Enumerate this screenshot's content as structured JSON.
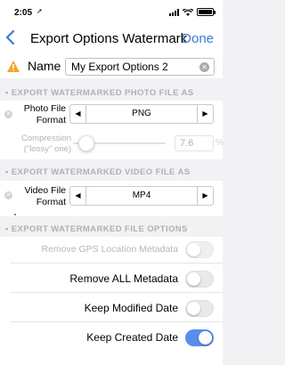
{
  "status_bar": {
    "time": "2:05",
    "location_arrow": "➚"
  },
  "nav": {
    "title": "Export Options Watermark",
    "done_label": "Done"
  },
  "name_row": {
    "label": "Name",
    "value": "My Export Options 2"
  },
  "photo_section": {
    "header": "EXPORT WATERMARKED PHOTO FILE AS",
    "format_label": "Photo File Format",
    "format_value": "PNG",
    "compression_label": "Compression (\"lossy\" one)",
    "compression_value": "7.6",
    "compression_unit": "%",
    "compression_level": 0.05
  },
  "video_section": {
    "header": "EXPORT WATERMARKED VIDEO FILE AS",
    "format_label": "Video File Format",
    "format_value": "MP4"
  },
  "file_options": {
    "header": "EXPORT WATERMARKED FILE OPTIONS",
    "items": [
      {
        "label": "Remove GPS Location Metadata",
        "on": false
      },
      {
        "label": "Remove ALL Metadata",
        "on": false
      },
      {
        "label": "Keep Modified Date",
        "on": false
      },
      {
        "label": "Keep Created Date",
        "on": true
      }
    ]
  },
  "colors": {
    "accent": "#3a7bd5",
    "toggle_on": "#5b8def",
    "warning": "#f5a623"
  }
}
